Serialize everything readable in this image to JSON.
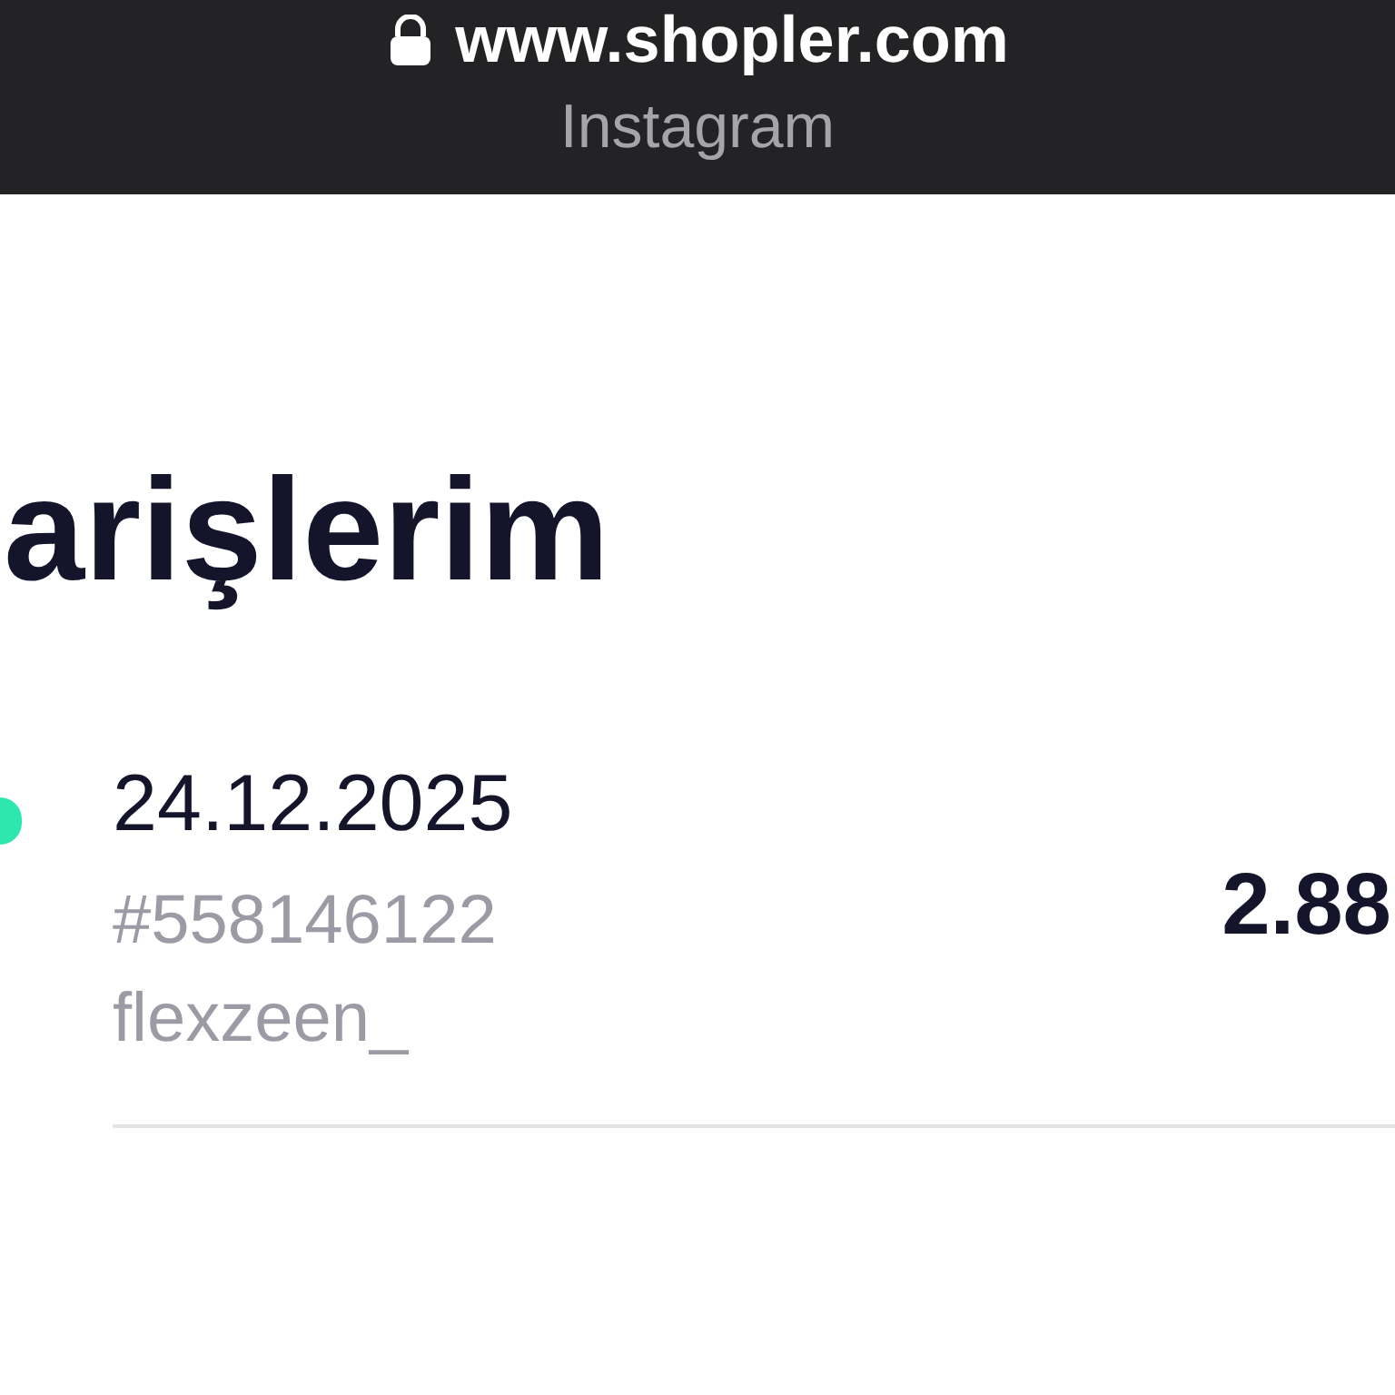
{
  "browser_bar": {
    "url": "www.shopler.com",
    "app": "Instagram"
  },
  "page": {
    "title": "arişlerim"
  },
  "orders": [
    {
      "date": "24.12.2025",
      "number": "#558146122",
      "username": "flexzeen_",
      "amount": "2.88"
    }
  ]
}
